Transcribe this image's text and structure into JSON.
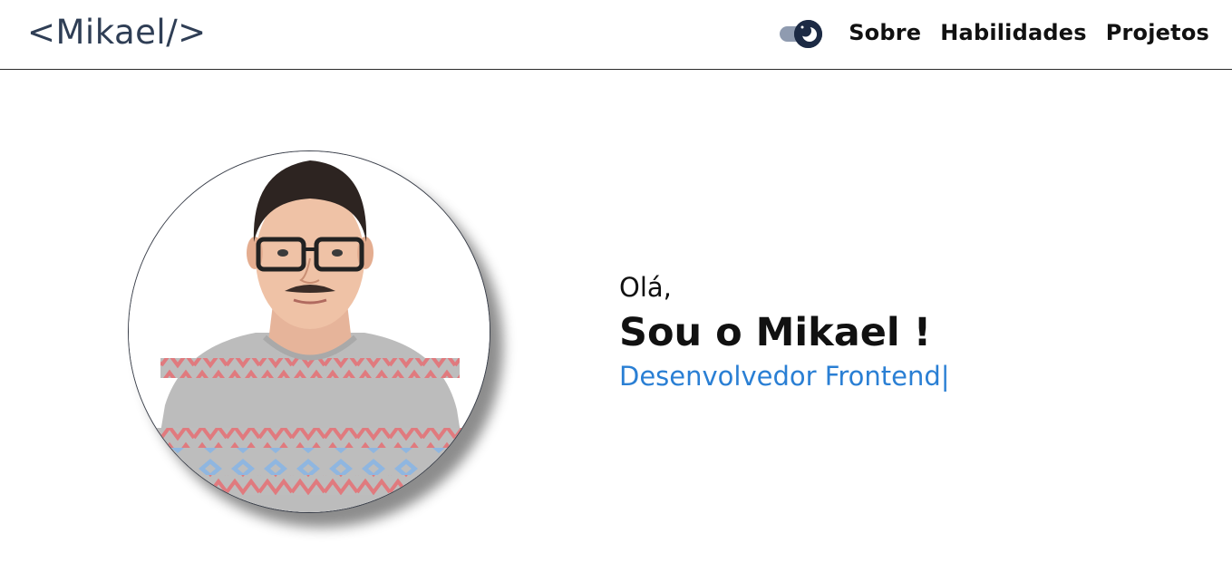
{
  "header": {
    "logo": "<Mikael/>",
    "theme_toggle": {
      "state": "dark",
      "track_color": "#8f9bb0",
      "knob_color": "#1c2a44"
    },
    "nav": [
      {
        "label": "Sobre"
      },
      {
        "label": "Habilidades"
      },
      {
        "label": "Projetos"
      }
    ]
  },
  "hero": {
    "greeting": "Olá,",
    "headline": "Sou o Mikael !",
    "role": "Desenvolvedor Frontend",
    "cursor": "|",
    "role_color": "#2a7fd4",
    "avatar": "profile-photo"
  }
}
